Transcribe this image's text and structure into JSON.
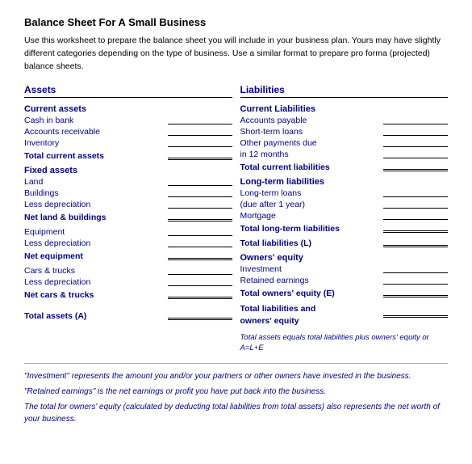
{
  "title": "Balance Sheet For A Small Business",
  "intro": "Use this worksheet to prepare the balance sheet you will include in your business plan.  Yours may have slightly different categories depending on the type of business.  Use a similar format to prepare pro forma (projected) balance sheets.",
  "assets": {
    "header": "Assets",
    "current_assets": {
      "header": "Current assets",
      "items": [
        "Cash in bank",
        "Accounts receivable",
        "Inventory"
      ],
      "total": "Total current assets"
    },
    "fixed_assets": {
      "header": "Fixed assets",
      "land": "Land",
      "buildings": "Buildings",
      "less_dep1": "Less depreciation",
      "net1": "Net land & buildings",
      "equipment": "Equipment",
      "less_dep2": "Less depreciation",
      "net2": "Net equipment",
      "cars": "Cars & trucks",
      "less_dep3": "Less depreciation",
      "net3": "Net cars & trucks"
    },
    "total": "Total assets (A)"
  },
  "liabilities": {
    "header": "Liabilities",
    "current": {
      "header": "Current Liabilities",
      "items": [
        "Accounts payable",
        "Short-term loans",
        "Other payments due",
        "in 12 months"
      ],
      "total": "Total current liabilities"
    },
    "longterm": {
      "header": "Long-term liabilities",
      "items": [
        "Long-term loans",
        "(due after 1 year)",
        "Mortgage"
      ],
      "total": "Total long-term liabilities"
    },
    "total_liabilities": "Total liabilities (L)",
    "owners_equity": {
      "header": "Owners' equity",
      "items": [
        "Investment",
        "Retained earnings"
      ],
      "total": "Total owners' equity (E)"
    },
    "total_both": {
      "label1": "Total liabilities and",
      "label2": "owners' equity",
      "sublabel": "Total assets equals total liabilities plus owners' equity or A=L+E"
    }
  },
  "footer": {
    "note1": "\"Investment\" represents the amount you and/or your partners or other owners have invested in the business.",
    "note2": "\"Retained earnings\" is the net earnings or profit you have put back into the business.",
    "note3": "The total for owners' equity (calculated by deducting total liabilities from total assets) also represents the net worth of your business."
  }
}
